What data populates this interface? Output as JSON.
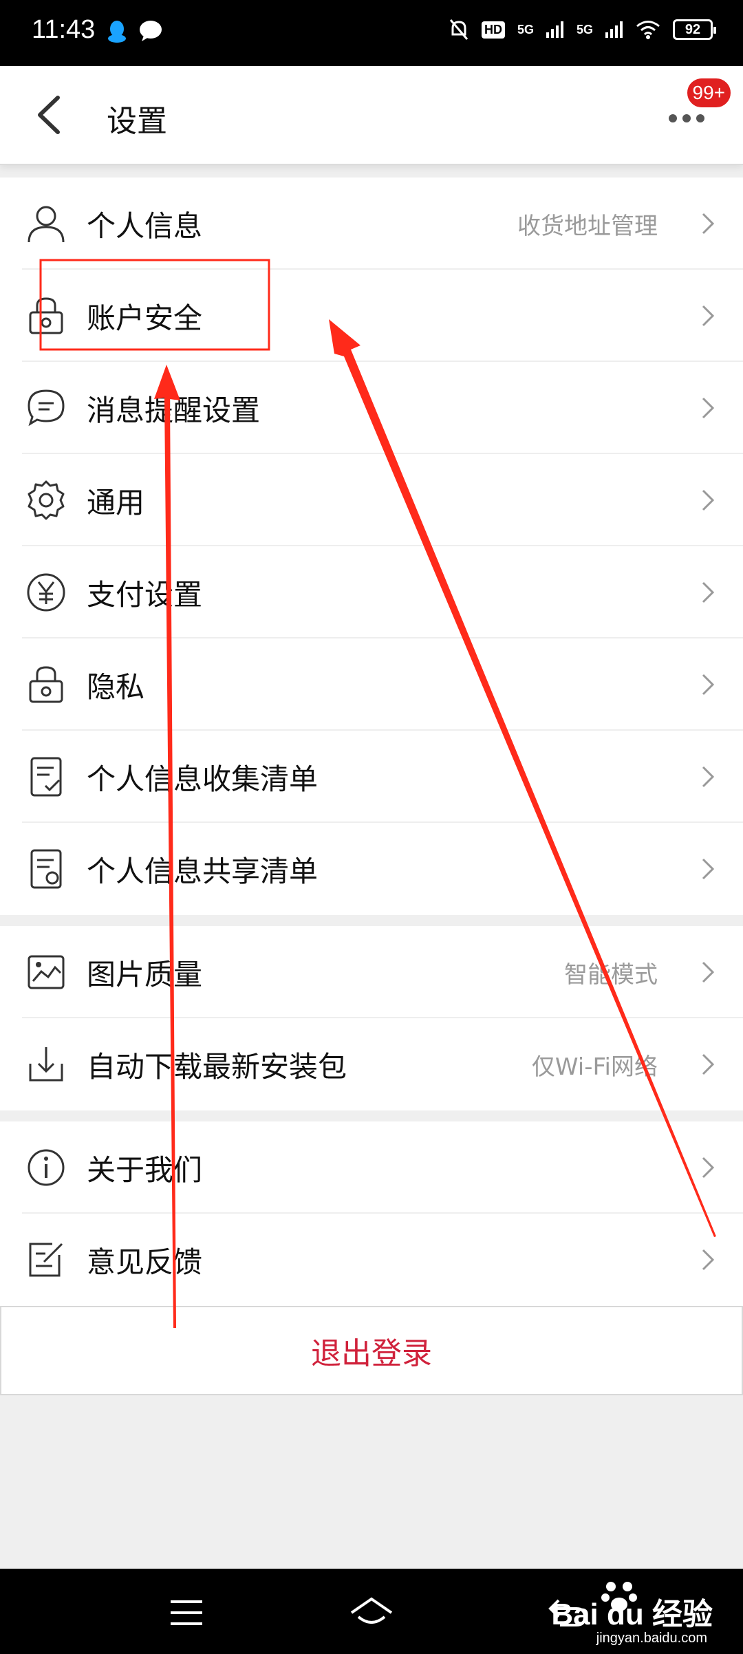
{
  "status": {
    "time": "11:43",
    "battery": "92",
    "signal_labels": [
      "5G",
      "5G"
    ],
    "hd_label": "HD"
  },
  "header": {
    "title": "设置",
    "badge": "99+"
  },
  "groups": [
    {
      "items": [
        {
          "label": "个人信息",
          "value": "收货地址管理",
          "icon": "user-icon"
        },
        {
          "label": "账户安全",
          "value": "",
          "icon": "lock-icon"
        },
        {
          "label": "消息提醒设置",
          "value": "",
          "icon": "chat-bubble-icon"
        },
        {
          "label": "通用",
          "value": "",
          "icon": "gear-icon"
        },
        {
          "label": "支付设置",
          "value": "",
          "icon": "yen-icon"
        },
        {
          "label": "隐私",
          "value": "",
          "icon": "lock-icon"
        },
        {
          "label": "个人信息收集清单",
          "value": "",
          "icon": "checklist-icon"
        },
        {
          "label": "个人信息共享清单",
          "value": "",
          "icon": "share-list-icon"
        }
      ]
    },
    {
      "items": [
        {
          "label": "图片质量",
          "value": "智能模式",
          "icon": "image-icon"
        },
        {
          "label": "自动下载最新安装包",
          "value": "仅Wi-Fi网络",
          "icon": "download-icon"
        }
      ]
    },
    {
      "items": [
        {
          "label": "关于我们",
          "value": "",
          "icon": "info-icon"
        },
        {
          "label": "意见反馈",
          "value": "",
          "icon": "feedback-icon"
        }
      ]
    }
  ],
  "logout_label": "退出登录",
  "watermark": {
    "main": "Bai du 经验",
    "sub": "jingyan.baidu.com"
  },
  "colors": {
    "accent": "#d0213b",
    "badge": "#e02020",
    "annotation": "#ff2a1a"
  }
}
